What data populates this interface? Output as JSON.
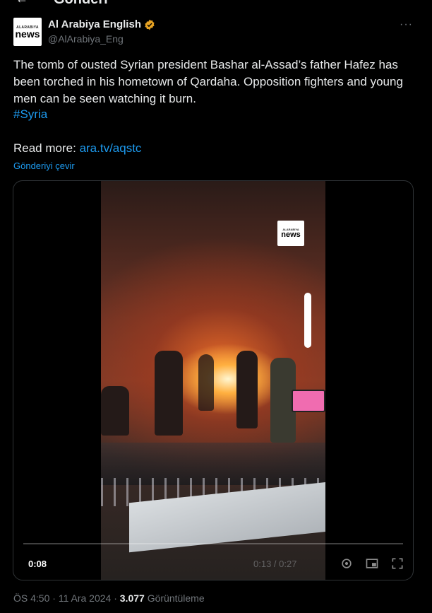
{
  "header": {
    "back_label": "←",
    "title": "Gönderi"
  },
  "tweet": {
    "account_name": "Al Arabiya English",
    "handle": "@AlArabiya_Eng",
    "more_label": "···",
    "avatar_text_top": "ALARABIYA",
    "avatar_text_bottom": "news",
    "body": "The tomb of ousted Syrian president Bashar al-Assad’s father Hafez has been torched in his hometown of Qardaha. Opposition fighters and young men can be seen watching it burn.",
    "hashtag": "#Syria",
    "read_more_label": "Read more:",
    "read_more_link": "ara.tv/aqstc",
    "translate_label": "Gönderiyi çevir"
  },
  "video": {
    "current_time": "0:08",
    "duration": "0:13 / 0:27",
    "watermark_top": "ALARABIYA",
    "watermark_bottom": "news",
    "progress": 0.3
  },
  "footer": {
    "time": "ÖS 4:50",
    "date": "11 Ara 2024",
    "separator": "·",
    "views_count": "3.077",
    "views_label": "Görüntüleme"
  },
  "colors": {
    "accent": "#1d9bf0",
    "background": "#000000",
    "verified": "#e8a323"
  }
}
